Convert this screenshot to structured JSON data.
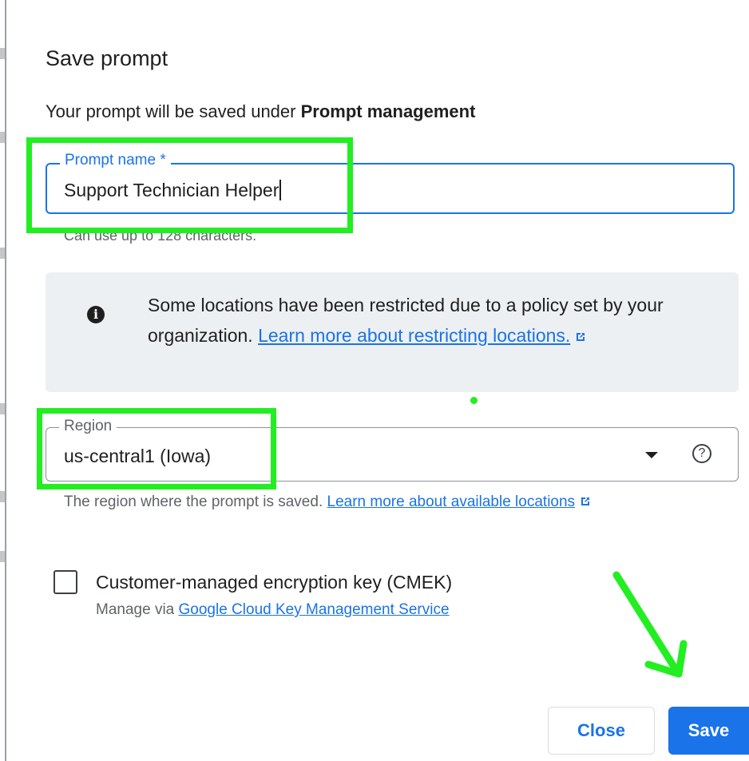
{
  "dialog": {
    "title": "Save prompt",
    "subtitle_prefix": "Your prompt will be saved under ",
    "subtitle_bold": "Prompt management"
  },
  "prompt_name": {
    "label": "Prompt name *",
    "value": "Support Technician Helper",
    "hint": "Can use up to 128 characters."
  },
  "info_banner": {
    "text": "Some locations have been restricted due to a policy set by your organization. ",
    "link": "Learn more about restricting locations.",
    "icon": "info-icon"
  },
  "region": {
    "label": "Region",
    "value": "us-central1 (Iowa)",
    "help_symbol": "?",
    "hint_text": "The region where the prompt is saved. ",
    "hint_link": "Learn more about available locations"
  },
  "cmek": {
    "label": "Customer-managed encryption key (CMEK)",
    "sub_prefix": "Manage via ",
    "sub_link": "Google Cloud Key Management Service",
    "checked": false
  },
  "actions": {
    "close_label": "Close",
    "save_label": "Save"
  },
  "colors": {
    "accent": "#1a73e8",
    "annotation": "#22ee22",
    "banner_bg": "#edf0f3"
  }
}
